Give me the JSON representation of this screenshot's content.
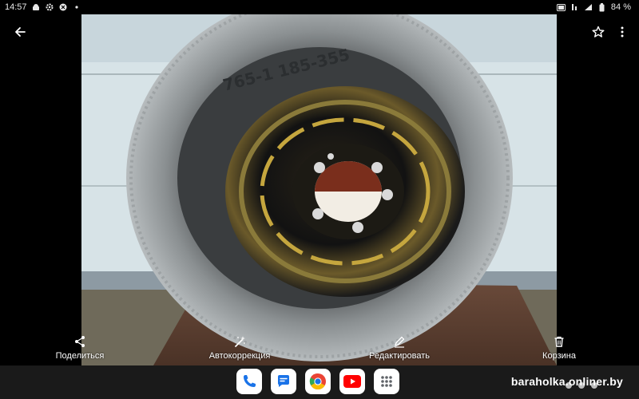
{
  "status_bar": {
    "time": "14:57",
    "battery": "84 %",
    "left_icons": [
      "android-icon",
      "gear-icon",
      "shield-icon",
      "notification-dot-icon"
    ],
    "right_icons": [
      "volte-icon",
      "network-4g-icon",
      "signal-icon",
      "battery-icon"
    ]
  },
  "top_bar": {
    "back_icon": "arrow-left-icon",
    "favorite_icon": "star-outline-icon",
    "menu_icon": "more-vertical-icon"
  },
  "photo": {
    "subject": "tire-on-steel-rim",
    "tire_sidewall_text": "765-1 185-355"
  },
  "actions": [
    {
      "label": "Поделиться",
      "icon": "share-icon"
    },
    {
      "label": "Автокоррекция",
      "icon": "magic-wand-icon"
    },
    {
      "label": "Редактировать",
      "icon": "pencil-icon"
    },
    {
      "label": "Корзина",
      "icon": "trash-icon"
    }
  ],
  "dock": {
    "apps": [
      {
        "name": "Phone",
        "icon": "phone-icon",
        "color": "#1a73e8"
      },
      {
        "name": "Messages",
        "icon": "messages-icon",
        "color": "#1a73e8"
      },
      {
        "name": "Chrome",
        "icon": "chrome-icon",
        "color": "#34a853"
      },
      {
        "name": "YouTube",
        "icon": "youtube-icon",
        "color": "#ff0000"
      },
      {
        "name": "All apps",
        "icon": "apps-grid-icon",
        "color": "#5f6368"
      }
    ]
  },
  "watermark": "baraholka.onliner.by"
}
